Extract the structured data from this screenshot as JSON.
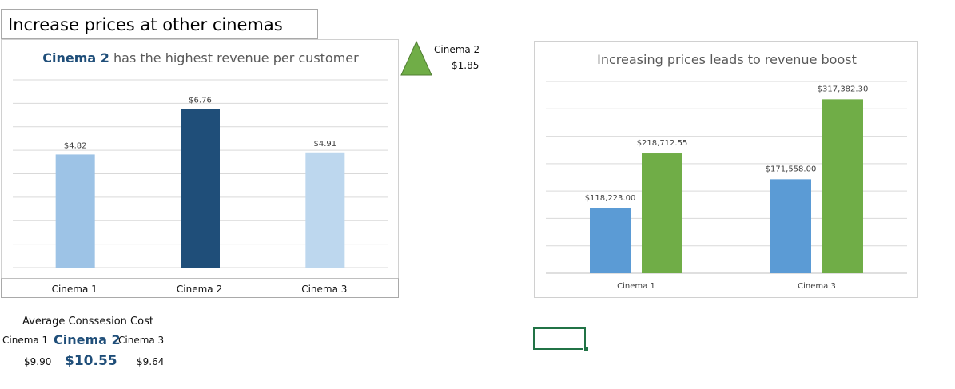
{
  "heading": "Increase prices at other cinemas",
  "left_chart_title": {
    "highlight": "Cinema 2",
    "rest": " has the highest revenue per customer"
  },
  "triangle_callout": {
    "label": "Cinema 2",
    "value": "$1.85",
    "color": "#70ad47"
  },
  "right_chart_title": "Increasing prices leads to revenue boost",
  "concession": {
    "title": "Average Conssesion Cost",
    "c1_label": "Cinema 1",
    "c2_label": "Cinema 2",
    "c3_label": "Cinema 3",
    "c1_value": "$9.90",
    "c2_value": "$10.55",
    "c3_value": "$9.64"
  },
  "colors": {
    "accent_dark_blue": "#1f4e79",
    "light_blue": "#9dc3e6",
    "lighter_blue": "#bdd7ee",
    "mid_blue": "#5b9bd5",
    "green": "#70ad47",
    "excel_green": "#217346"
  },
  "chart_data": [
    {
      "type": "bar",
      "title": "Cinema 2 has the highest revenue per customer",
      "categories": [
        "Cinema 1",
        "Cinema 2",
        "Cinema 3"
      ],
      "values": [
        4.82,
        6.76,
        4.91
      ],
      "value_labels": [
        "$4.82",
        "$6.76",
        "$4.91"
      ],
      "bar_colors": [
        "#9dc3e6",
        "#1f4e79",
        "#bdd7ee"
      ],
      "ylim": [
        0,
        8
      ],
      "grid": true,
      "legend": "none"
    },
    {
      "type": "bar",
      "title": "Increasing prices leads to revenue boost",
      "categories": [
        "Cinema 1",
        "Cinema 3"
      ],
      "series": [
        {
          "values": [
            118223.0,
            171558.0
          ],
          "value_labels": [
            "$118,223.00",
            "$171,558.00"
          ],
          "color": "#5b9bd5"
        },
        {
          "values": [
            218712.55,
            317382.3
          ],
          "value_labels": [
            "$218,712.55",
            "$317,382.30"
          ],
          "color": "#70ad47"
        }
      ],
      "ylim": [
        0,
        350000
      ],
      "grid": true,
      "legend": "none"
    }
  ]
}
